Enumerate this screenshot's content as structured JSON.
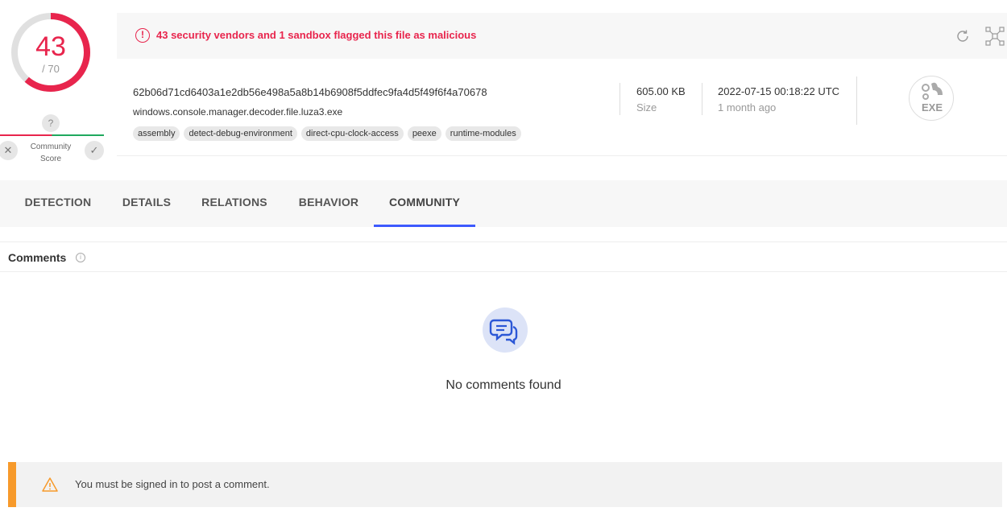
{
  "score": {
    "detections": "43",
    "total": "/ 70",
    "detection_ratio": 0.614,
    "community_question": "?",
    "community_label_line1": "Community",
    "community_label_line2": "Score"
  },
  "alert": {
    "icon": "!",
    "text": "43 security vendors and 1 sandbox flagged this file as malicious"
  },
  "file": {
    "hash": "62b06d71cd6403a1e2db56e498a5a8b14b6908f5ddfec9fa4d5f49f6f4a70678",
    "name": "windows.console.manager.decoder.file.luza3.exe",
    "tags": [
      "assembly",
      "detect-debug-environment",
      "direct-cpu-clock-access",
      "peexe",
      "runtime-modules"
    ],
    "size_value": "605.00 KB",
    "size_label": "Size",
    "date_value": "2022-07-15 00:18:22 UTC",
    "date_label": "1 month ago",
    "type_label": "EXE"
  },
  "tabs": [
    {
      "label": "DETECTION",
      "active": false
    },
    {
      "label": "DETAILS",
      "active": false
    },
    {
      "label": "RELATIONS",
      "active": false
    },
    {
      "label": "BEHAVIOR",
      "active": false
    },
    {
      "label": "COMMUNITY",
      "active": true
    }
  ],
  "comments": {
    "title": "Comments",
    "info": "i",
    "empty_text": "No comments found"
  },
  "signin": {
    "text": "You must be signed in to post a comment."
  },
  "colors": {
    "malicious": "#e8254d",
    "accent": "#3d5afe",
    "warning": "#f79a2b",
    "harmless": "#20a95e"
  }
}
